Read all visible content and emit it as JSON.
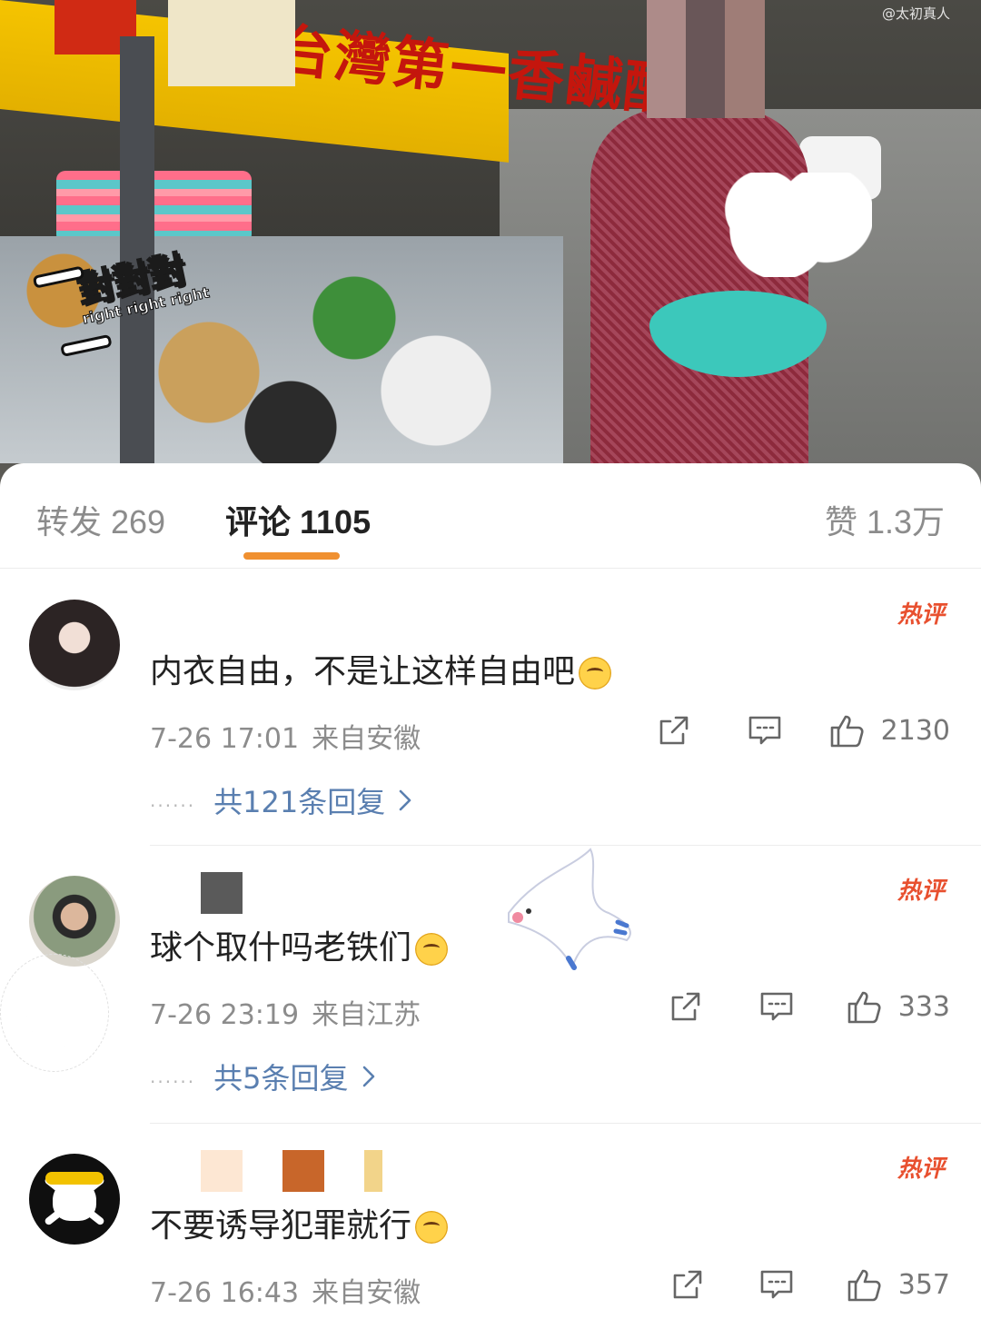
{
  "video": {
    "watermark": "@太初真人",
    "sign_text": "台灣第一香鹹酥",
    "sticker_text": "對對對",
    "sticker_subtext": "right right right"
  },
  "tabs": {
    "repost": "转发 269",
    "comments": "评论 1105",
    "likes": "赞 1.3万"
  },
  "colors": {
    "accent_underline": "#f09030",
    "hot_badge": "#e8502f",
    "reply_link": "#5a7fb0"
  },
  "comments": [
    {
      "avatar_icon": "avatar-girl",
      "badge": "热评",
      "text": "内衣自由，不是让这样自由吧",
      "emoji": "astonished-emoji",
      "time": "7-26 17:01",
      "location": "来自安徽",
      "likes": "2130",
      "replies": "共121条回复",
      "name_colors": []
    },
    {
      "avatar_icon": "avatar-man",
      "badge": "热评",
      "text": "球个取什吗老铁们",
      "emoji": "glasses-emoji",
      "time": "7-26 23:19",
      "location": "来自江苏",
      "likes": "333",
      "replies": "共5条回复",
      "name_colors": [
        "#5a5a5a"
      ]
    },
    {
      "avatar_icon": "avatar-skull",
      "badge": "热评",
      "text": "不要诱导犯罪就行",
      "emoji": "laughing-emoji",
      "time": "7-26 16:43",
      "location": "来自安徽",
      "likes": "357",
      "replies": "",
      "name_colors": [
        "#fde7d3",
        "#c8662a",
        "#f2d48a"
      ]
    }
  ]
}
